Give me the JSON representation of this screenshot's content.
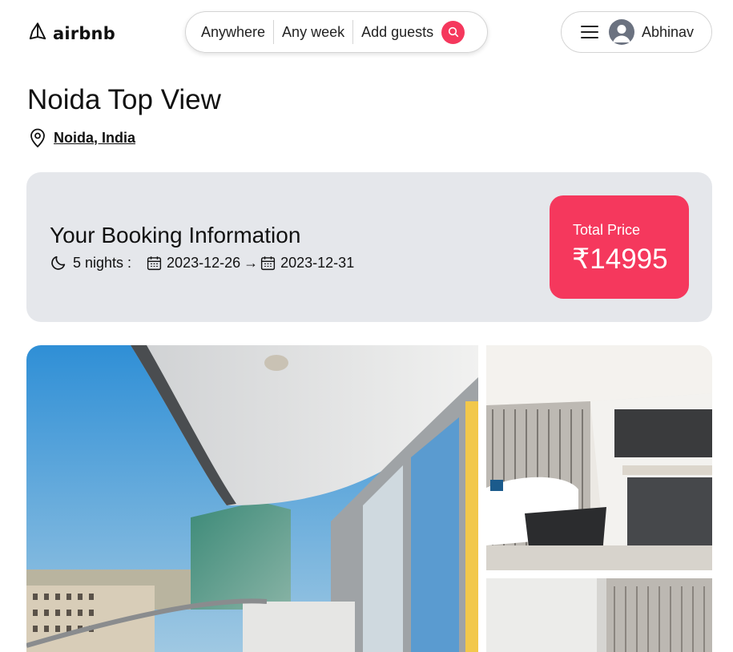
{
  "header": {
    "logo_text": "airbnb",
    "search": {
      "anywhere": "Anywhere",
      "any_week": "Any week",
      "add_guests": "Add guests"
    },
    "user_name": "Abhinav"
  },
  "listing": {
    "title": "Noida Top View",
    "location": "Noida, India"
  },
  "booking": {
    "heading": "Your Booking Information",
    "nights": "5 nights :",
    "check_in": "2023-12-26",
    "arrow": "→",
    "check_out": "2023-12-31",
    "price_label": "Total Price",
    "price_value": "₹14995"
  },
  "colors": {
    "brand": "#f5385d",
    "card_bg": "#e5e7eb"
  }
}
